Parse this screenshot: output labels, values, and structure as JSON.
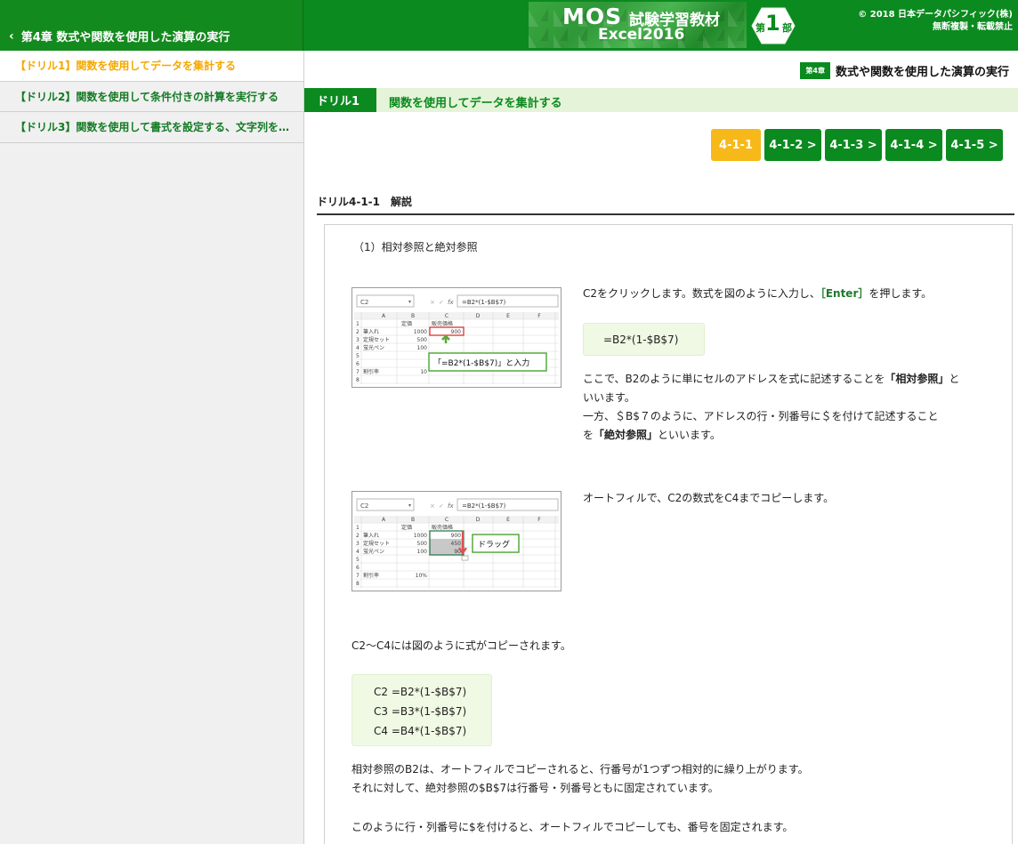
{
  "header": {
    "back_label": "第4章 数式や関数を使用した演算の実行",
    "banner_mos": "MOS",
    "banner_jp": "試験学習教材",
    "banner_excel": "Excel2016",
    "badge_dai": "第",
    "badge_num": "1",
    "badge_bu": "部",
    "copyright": "© 2018 日本データパシフィック(株)",
    "copyright_note": "無断複製・転載禁止"
  },
  "sidebar": {
    "items": [
      {
        "label": "【ドリル1】関数を使用してデータを集計する"
      },
      {
        "label": "【ドリル2】関数を使用して条件付きの計算を実行する"
      },
      {
        "label": "【ドリル3】関数を使用して書式を設定する、文字列を…"
      }
    ]
  },
  "main": {
    "chapter_badge": "第4章",
    "chapter_title": "数式や関数を使用した演算の実行",
    "drill_tag": "ドリル1",
    "drill_title": "関数を使用してデータを集計する",
    "tabs": [
      {
        "label": "4-1-1"
      },
      {
        "label": "4-1-2 >"
      },
      {
        "label": "4-1-3 >"
      },
      {
        "label": "4-1-4 >"
      },
      {
        "label": "4-1-5 >"
      }
    ],
    "section_title": "ドリル4-1-1　解説",
    "subheading": "（1）相対参照と絶対参照",
    "step1_a": "C2をクリックします。数式を図のように入力し、",
    "step1_enter": "［Enter］",
    "step1_b": "を押します。",
    "formula1": "=B2*(1-$B$7)",
    "exp_1": "ここで、B2のように単にセルのアドレスを式に記述することを",
    "exp_term1": "「相対参照」",
    "exp_2": "といいます。",
    "exp_3": "一方、＄B$７のように、アドレスの行・列番号に＄を付けて記述すること",
    "exp_4": "を",
    "exp_term2": "「絶対参照」",
    "exp_5": "といいます。",
    "step2": "オートフィルで、C2の数式をC4までコピーします。",
    "copied": "C2～C4には図のように式がコピーされます。",
    "formulas": [
      "C2 =B2*(1-$B$7)",
      "C3 =B3*(1-$B$7)",
      "C4 =B4*(1-$B$7)"
    ],
    "note1": "相対参照のB2は、オートフィルでコピーされると、行番号が1つずつ相対的に繰り上がります。",
    "note2": "それに対して、絶対参照の$B$7は行番号・列番号ともに固定されています。",
    "note3": "このように行・列番号に$を付けると、オートフィルでコピーしても、番号を固定されます。"
  },
  "excel1": {
    "namebox": "C2",
    "fx": "fx",
    "formula_bar": "=B2*(1-$B$7)",
    "cols": [
      "A",
      "B",
      "C",
      "D",
      "E",
      "F"
    ],
    "rows": [
      "1",
      "2",
      "3",
      "4",
      "5",
      "6",
      "7",
      "8"
    ],
    "hdr_b": "定価",
    "hdr_c": "販売価格",
    "a2": "筆入れ",
    "b2": "1000",
    "c2": "900",
    "a3": "定規セット",
    "b3": "500",
    "a4": "蛍光ペン",
    "b4": "100",
    "a7": "割引率",
    "b7": "10",
    "callout": "「=B2*(1-$B$7)」と入力"
  },
  "excel2": {
    "namebox": "C2",
    "fx": "fx",
    "formula_bar": "=B2*(1-$B$7)",
    "cols": [
      "A",
      "B",
      "C",
      "D",
      "E",
      "F"
    ],
    "rows": [
      "1",
      "2",
      "3",
      "4",
      "5",
      "6",
      "7",
      "8"
    ],
    "hdr_b": "定価",
    "hdr_c": "販売価格",
    "a2": "筆入れ",
    "b2": "1000",
    "c2": "900",
    "a3": "定規セット",
    "b3": "500",
    "c3": "450",
    "a4": "蛍光ペン",
    "b4": "100",
    "c4": "90",
    "a7": "割引率",
    "b7": "10%",
    "callout": "ドラッグ"
  },
  "colors": {
    "primary_green": "#0b8a1f",
    "active_orange": "#f5a800",
    "tab_current": "#f7b91a",
    "drill_bar_bg": "#e5f4d8",
    "formula_bg": "#f0f9e3"
  }
}
